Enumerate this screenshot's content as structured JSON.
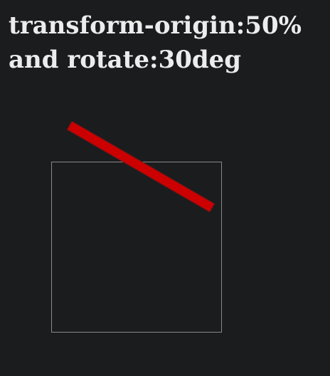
{
  "heading": {
    "line1": "transform-origin:50%",
    "line2": "and rotate:30deg"
  },
  "demo": {
    "bar_color": "#cc0000",
    "box_border_color": "#8a8a85",
    "rotation_deg": 30
  }
}
